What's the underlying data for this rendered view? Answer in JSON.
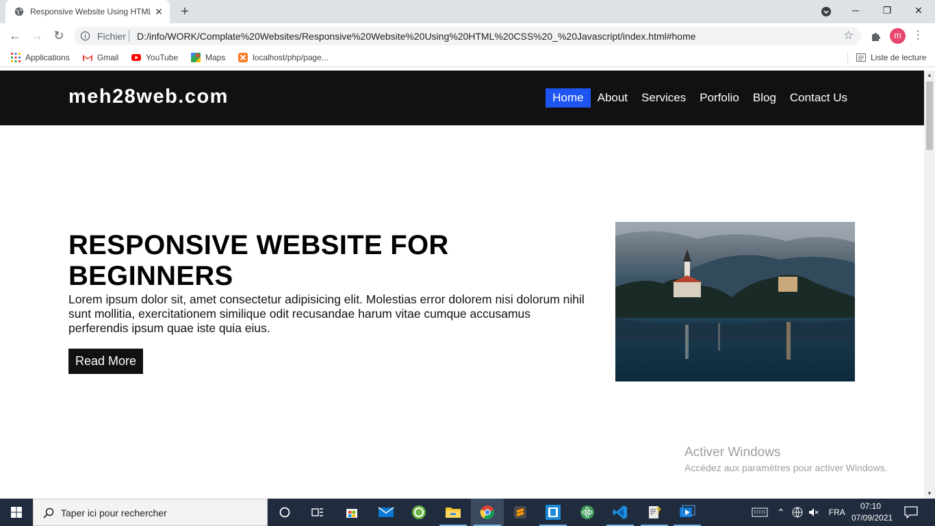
{
  "browser": {
    "tab_title": "Responsive Website Using HTML",
    "info_label": "Fichier",
    "url": "D:/info/WORK/Complate%20Websites/Responsive%20Website%20Using%20HTML%20CSS%20_%20Javascript/index.html#home",
    "avatar_letter": "m",
    "bookmarks": [
      {
        "label": "Applications",
        "icon": "apps-grid-icon"
      },
      {
        "label": "Gmail",
        "icon": "gmail-icon"
      },
      {
        "label": "YouTube",
        "icon": "youtube-icon"
      },
      {
        "label": "Maps",
        "icon": "maps-icon"
      },
      {
        "label": "localhost/php/page...",
        "icon": "xampp-icon"
      }
    ],
    "reading_list": "Liste de lecture"
  },
  "site": {
    "logo": "meh28web.com",
    "nav": [
      "Home",
      "About",
      "Services",
      "Porfolio",
      "Blog",
      "Contact Us"
    ],
    "active_nav": "Home",
    "accent_color": "#1e55f2",
    "hero": {
      "title": "RESPONSIVE WEBSITE FOR BEGINNERS",
      "text": "Lorem ipsum dolor sit, amet consectetur adipisicing elit. Molestias error dolorem nisi dolorum nihil sunt mollitia, exercitationem similique odit recusandae harum vitae cumque accusamus perferendis ipsum quae iste quia eius.",
      "button": "Read More"
    }
  },
  "watermark": {
    "title": "Activer Windows",
    "subtitle": "Accédez aux paramètres pour activer Windows."
  },
  "taskbar": {
    "search_placeholder": "Taper ici pour rechercher",
    "language": "FRA",
    "time": "07:10",
    "date": "07/09/2021"
  }
}
